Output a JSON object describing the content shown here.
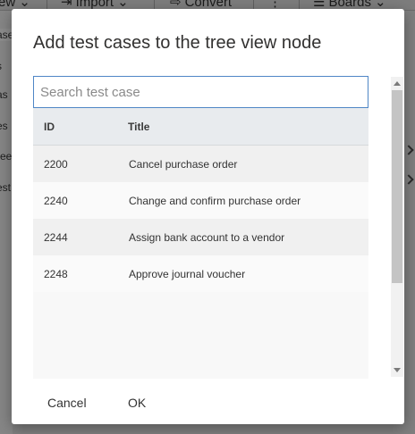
{
  "background": {
    "toolbar": {
      "view_label": "ew",
      "import_label": "Import",
      "convert_label": "Convert",
      "boards_label": "Boards"
    },
    "left_panel_items": [
      "ase",
      "s",
      "as",
      "es",
      "ree",
      "est"
    ]
  },
  "dialog": {
    "title": "Add test cases to the tree view node",
    "search": {
      "placeholder": "Search test case",
      "value": ""
    },
    "table": {
      "columns": [
        "ID",
        "Title"
      ],
      "rows": [
        {
          "id": "2200",
          "title": "Cancel purchase order"
        },
        {
          "id": "2240",
          "title": "Change and confirm purchase order"
        },
        {
          "id": "2244",
          "title": "Assign bank account to a vendor"
        },
        {
          "id": "2248",
          "title": "Approve journal voucher"
        }
      ]
    },
    "buttons": {
      "cancel": "Cancel",
      "ok": "OK"
    }
  },
  "colors": {
    "overlay": "#7f7f7f",
    "accent_border": "#4f86c6",
    "header_bg": "#e8ebee"
  }
}
